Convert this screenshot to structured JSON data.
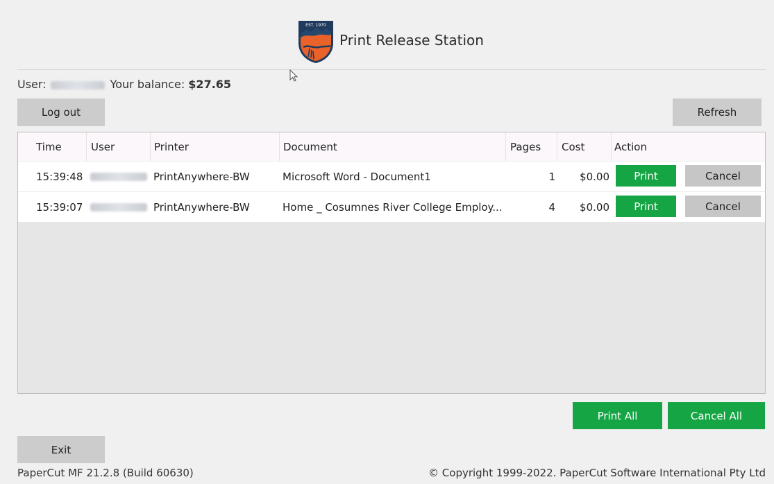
{
  "app": {
    "title": "Print Release Station",
    "logo_text": "EST. 1970"
  },
  "session": {
    "user_label": "User:",
    "balance_label": "Your balance:",
    "balance_value": "$27.65"
  },
  "toolbar": {
    "logout_label": "Log out",
    "refresh_label": "Refresh"
  },
  "table": {
    "columns": [
      "Time",
      "User",
      "Printer",
      "Document",
      "Pages",
      "Cost",
      "Action"
    ],
    "rows": [
      {
        "time": "15:39:48",
        "printer": "PrintAnywhere-BW",
        "document": "Microsoft Word - Document1",
        "pages": "1",
        "cost": "$0.00",
        "print_label": "Print",
        "cancel_label": "Cancel"
      },
      {
        "time": "15:39:07",
        "printer": "PrintAnywhere-BW",
        "document": "Home _ Cosumnes River College Employ...",
        "pages": "4",
        "cost": "$0.00",
        "print_label": "Print",
        "cancel_label": "Cancel"
      }
    ]
  },
  "bulk_actions": {
    "print_all_label": "Print All",
    "cancel_all_label": "Cancel All"
  },
  "footer": {
    "exit_label": "Exit",
    "version": "PaperCut MF  21.2.8 (Build 60630)",
    "copyright": "© Copyright 1999-2022. PaperCut Software International Pty Ltd"
  },
  "colors": {
    "background": "#f0f0f0",
    "green_button": "#16a544",
    "gray_button": "#cccccc",
    "logo_orange": "#e8622a",
    "logo_navy": "#1f3a5c"
  }
}
